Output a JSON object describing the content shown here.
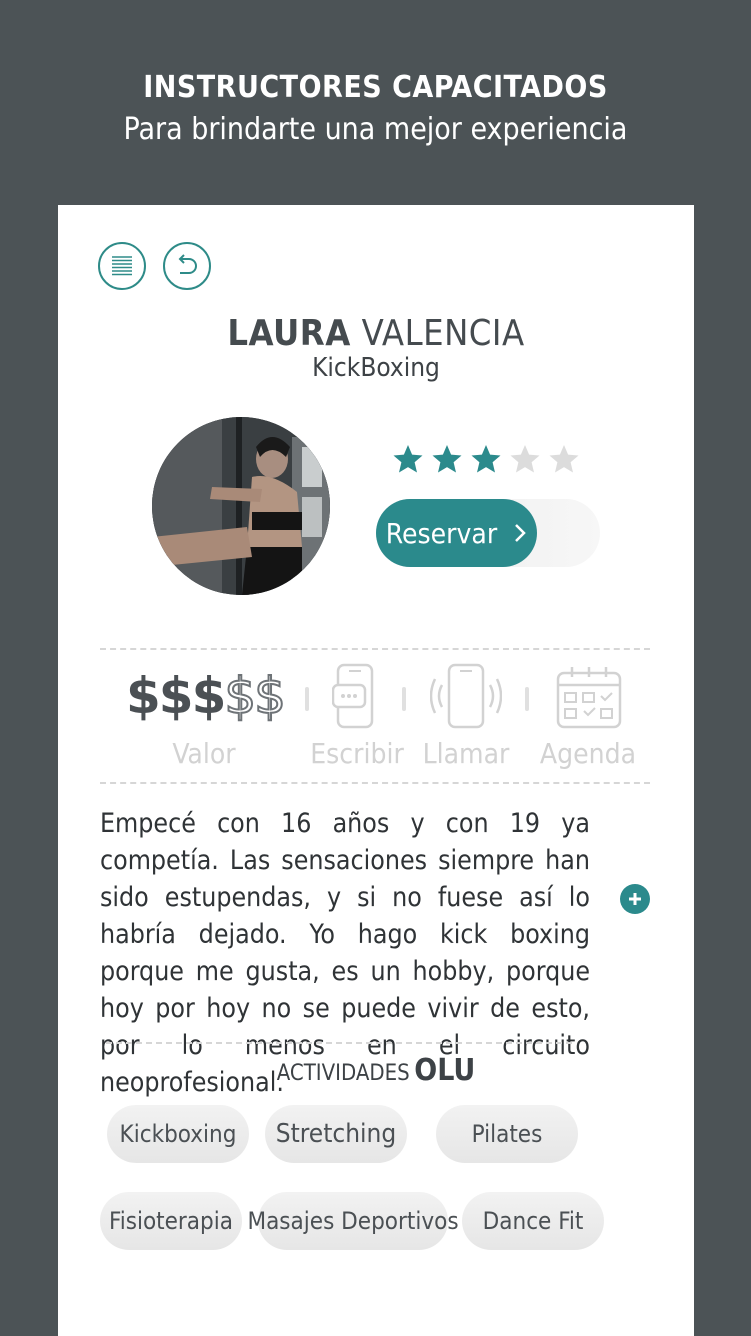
{
  "header": {
    "title": "INSTRUCTORES CAPACITADOS",
    "subtitle": "Para brindarte una mejor experiencia"
  },
  "toolbar": {
    "menu_icon": "list-icon",
    "back_icon": "undo-arrow-icon"
  },
  "instructor": {
    "first_name": "LAURA",
    "last_name": "VALENCIA",
    "discipline": "KickBoxing",
    "rating": 3,
    "rating_max": 5,
    "photo_icon": "instructor-photo"
  },
  "reserve": {
    "label": "Reservar",
    "icon": "chevron-right-icon"
  },
  "info_bar": {
    "price_active": "$$$",
    "price_inactive": "$$",
    "price_label": "Valor",
    "write_label": "Escribir",
    "call_label": "Llamar",
    "agenda_label": "Agenda"
  },
  "bio": {
    "text": "Empecé con 16 años y con 19 ya competía. Las sensaciones siempre han sido estupendas, y si no fuese así lo habría dejado. Yo hago kick boxing porque me gusta, es un hobby, porque hoy por hoy no se puede vivir de esto, por lo menos en el circuito neoprofesional.",
    "more_icon": "plus-circle-icon"
  },
  "activities": {
    "title_prefix": "ACTIVIDADES",
    "title_brand": "OLU",
    "items": [
      "Kickboxing",
      "Stretching",
      "Pilates",
      "Fisioterapia",
      "Masajes Deportivos",
      "Dance Fit"
    ]
  },
  "colors": {
    "background": "#4c5356",
    "accent": "#2b8a8c",
    "star_inactive": "#d8d8d8"
  }
}
